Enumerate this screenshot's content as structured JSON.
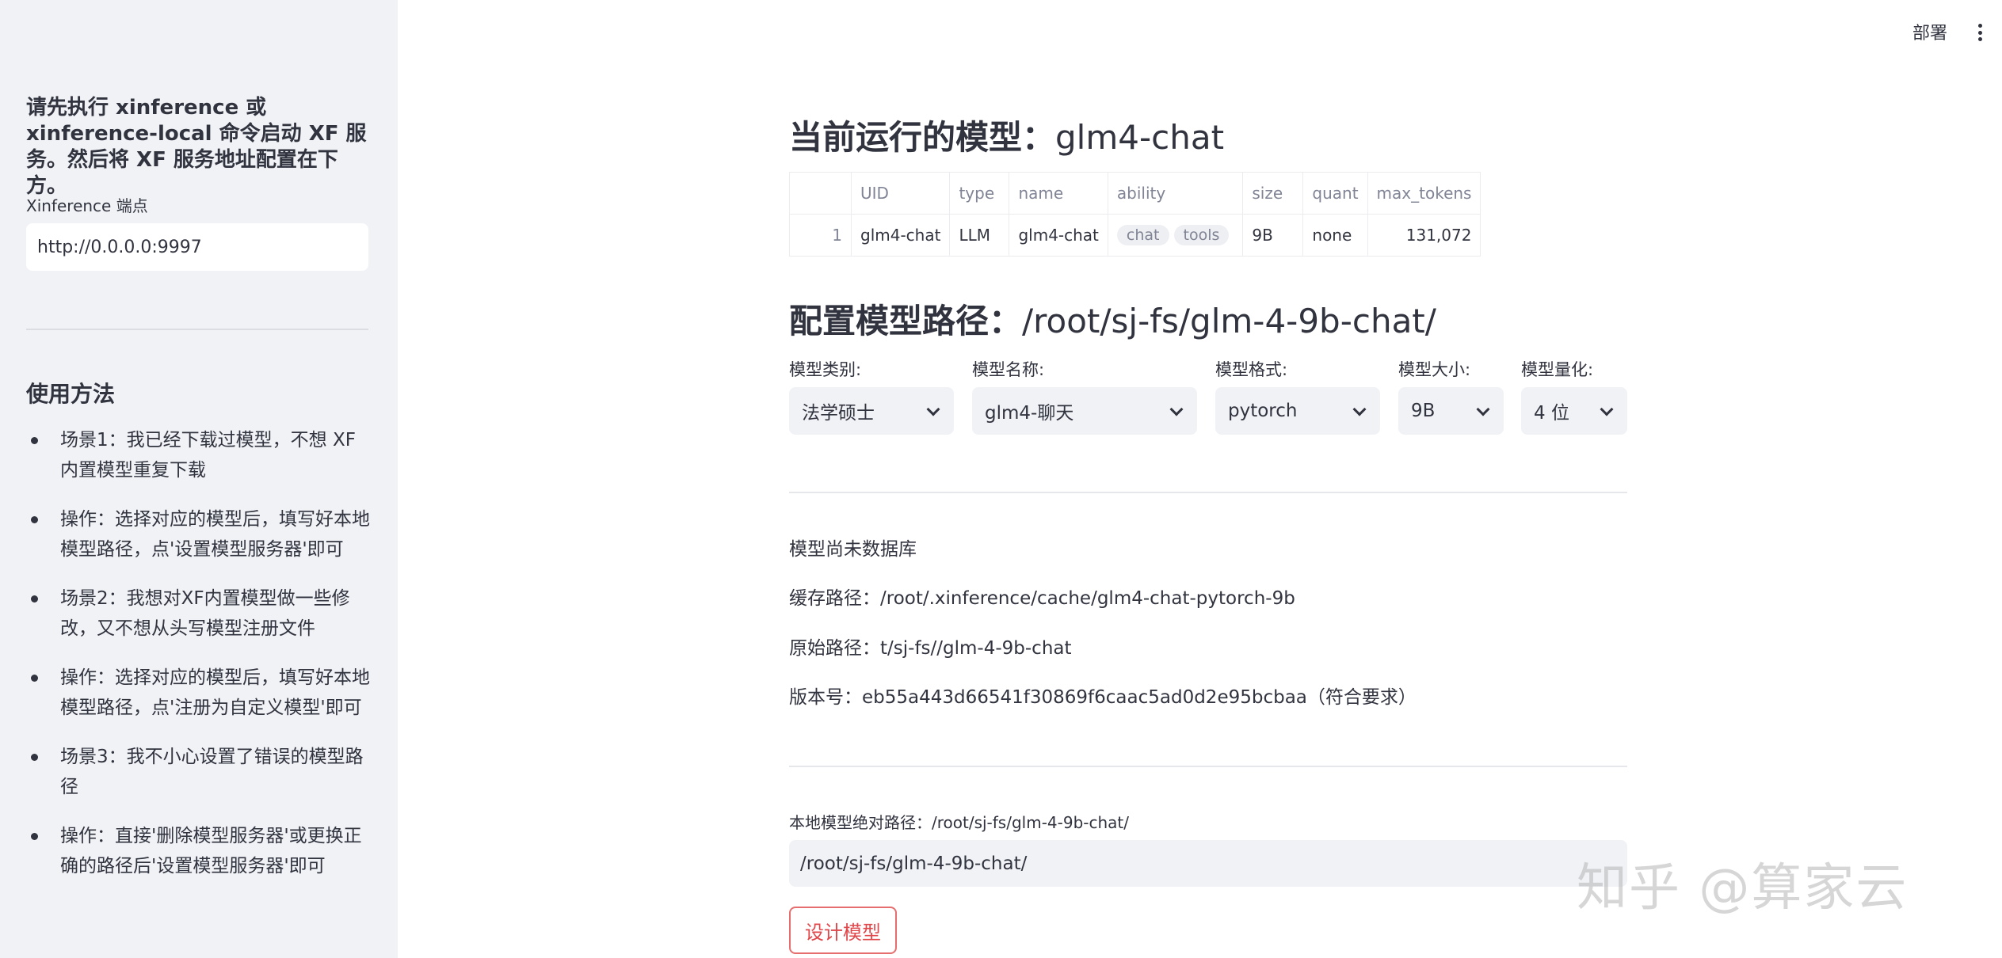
{
  "sidebar": {
    "intro": "请先执行 xinference 或 xinference-local 命令启动 XF 服务。然后将 XF 服务地址配置在下方。",
    "endpoint_label": "Xinference 端点",
    "endpoint_value": "http://0.0.0.0:9997",
    "usage_title": "使用方法",
    "usage_items": [
      "场景1：我已经下载过模型，不想 XF 内置模型重复下载",
      "操作：选择对应的模型后，填写好本地模型路径，点'设置模型服务器'即可",
      "场景2：我想对XF内置模型做一些修改，又不想从头写模型注册文件",
      "操作：选择对应的模型后，填写好本地模型路径，点'注册为自定义模型'即可",
      "场景3：我不小心设置了错误的模型路径",
      "操作：直接'删除模型服务器'或更换正确的路径后'设置模型服务器'即可"
    ]
  },
  "topbar": {
    "deploy_label": "部署",
    "menu_icon": "kebab-menu-icon"
  },
  "main": {
    "running_title": "当前运行的模型：",
    "running_model": "glm4-chat",
    "table": {
      "headers": [
        "UID",
        "type",
        "name",
        "ability",
        "size",
        "quant",
        "max_tokens"
      ],
      "rows": [
        {
          "index": "1",
          "uid": "glm4-chat",
          "type": "LLM",
          "name": "glm4-chat",
          "ability": [
            "chat",
            "tools"
          ],
          "size": "9B",
          "quant": "none",
          "max_tokens": "131,072"
        }
      ]
    },
    "config_title": "配置模型路径：",
    "config_path": "/root/sj-fs/glm-4-9b-chat/",
    "selects": [
      {
        "label": "模型类别:",
        "value": "法学硕士"
      },
      {
        "label": "模型名称:",
        "value": "glm4-聊天"
      },
      {
        "label": "模型格式:",
        "value": "pytorch"
      },
      {
        "label": "模型大小:",
        "value": "9B"
      },
      {
        "label": "模型量化:",
        "value": "4 位"
      }
    ],
    "info": {
      "status": "模型尚未数据库",
      "cache_path": "缓存路径：/root/.xinference/cache/glm4-chat-pytorch-9b",
      "origin_path": "原始路径：t/sj-fs//glm-4-9b-chat",
      "version": "版本号：eb55a443d66541f30869f6caac5ad0d2e95bcbaa（符合要求）"
    },
    "local_path_label": "本地模型绝对路径：/root/sj-fs/glm-4-9b-chat/",
    "local_path_value": "/root/sj-fs/glm-4-9b-chat/",
    "design_button": "设计模型"
  },
  "watermark": "知乎 @算家云",
  "colors": {
    "sidebar_bg": "#f0f2f6",
    "text": "#31333f",
    "button_accent": "#e0474b"
  }
}
